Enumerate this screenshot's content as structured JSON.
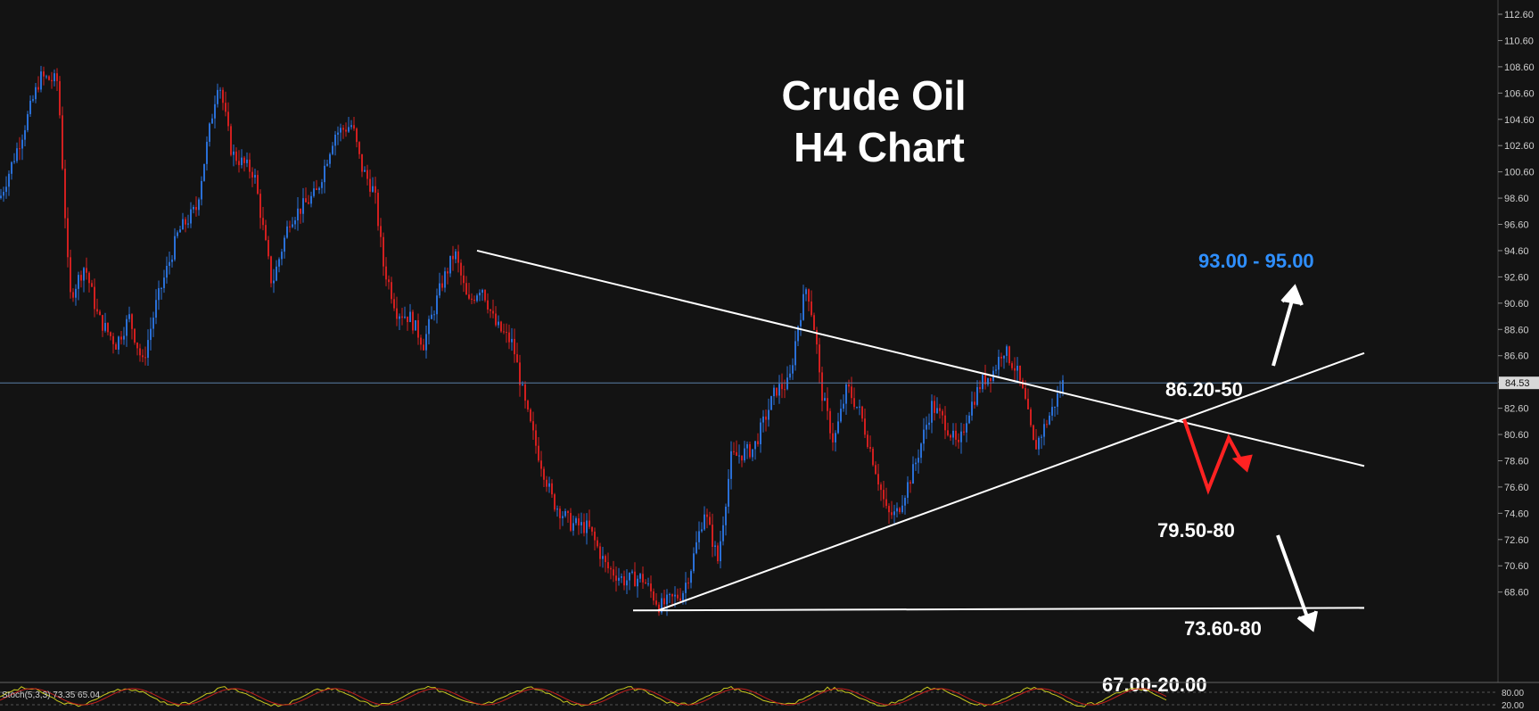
{
  "chart_data": {
    "type": "candlestick",
    "title": [
      "Crude Oil",
      "H4 Chart"
    ],
    "ylim": [
      66.6,
      113.0
    ],
    "y_ticks": [
      "112.60",
      "110.60",
      "108.60",
      "106.60",
      "104.60",
      "102.60",
      "100.60",
      "98.60",
      "96.60",
      "94.60",
      "92.60",
      "90.60",
      "88.60",
      "86.60",
      "84.60",
      "82.60",
      "80.60",
      "78.60",
      "76.60",
      "74.60",
      "72.60",
      "70.60",
      "68.60"
    ],
    "current_price": {
      "value": 84.53,
      "label": "84.53"
    },
    "price_path": [
      [
        0,
        98.6
      ],
      [
        25,
        103.5
      ],
      [
        45,
        107.8
      ],
      [
        65,
        107.5
      ],
      [
        78,
        91.0
      ],
      [
        95,
        93.5
      ],
      [
        110,
        89.5
      ],
      [
        130,
        87.5
      ],
      [
        145,
        89.5
      ],
      [
        160,
        86.0
      ],
      [
        175,
        90.5
      ],
      [
        200,
        96.0
      ],
      [
        220,
        97.8
      ],
      [
        245,
        107.8
      ],
      [
        260,
        102.0
      ],
      [
        285,
        100.5
      ],
      [
        305,
        92.0
      ],
      [
        325,
        97.0
      ],
      [
        355,
        99.0
      ],
      [
        375,
        103.5
      ],
      [
        395,
        104.2
      ],
      [
        405,
        101.0
      ],
      [
        420,
        99.0
      ],
      [
        430,
        93.5
      ],
      [
        445,
        90.0
      ],
      [
        460,
        89.5
      ],
      [
        475,
        87.5
      ],
      [
        495,
        92.0
      ],
      [
        510,
        94.5
      ],
      [
        525,
        90.5
      ],
      [
        540,
        92.0
      ],
      [
        555,
        89.0
      ],
      [
        575,
        87.5
      ],
      [
        590,
        82.5
      ],
      [
        600,
        80.0
      ],
      [
        620,
        75.5
      ],
      [
        640,
        73.8
      ],
      [
        660,
        73.5
      ],
      [
        680,
        70.5
      ],
      [
        700,
        69.5
      ],
      [
        720,
        69.7
      ],
      [
        740,
        67.5
      ],
      [
        765,
        68.5
      ],
      [
        775,
        70.5
      ],
      [
        790,
        74.8
      ],
      [
        805,
        71.0
      ],
      [
        820,
        78.8
      ],
      [
        845,
        79.5
      ],
      [
        870,
        84.0
      ],
      [
        885,
        84.5
      ],
      [
        895,
        89.0
      ],
      [
        905,
        92.0
      ],
      [
        915,
        88.0
      ],
      [
        920,
        84.2
      ],
      [
        935,
        80.0
      ],
      [
        950,
        84.2
      ],
      [
        965,
        82.2
      ],
      [
        980,
        78.5
      ],
      [
        995,
        74.5
      ],
      [
        1005,
        74.5
      ],
      [
        1025,
        78.0
      ],
      [
        1045,
        82.8
      ],
      [
        1060,
        81.5
      ],
      [
        1075,
        79.5
      ],
      [
        1085,
        82.2
      ],
      [
        1100,
        84.5
      ],
      [
        1115,
        85.5
      ],
      [
        1125,
        87.2
      ],
      [
        1140,
        85.5
      ],
      [
        1150,
        83.0
      ],
      [
        1160,
        79.5
      ],
      [
        1170,
        81.0
      ],
      [
        1180,
        82.5
      ],
      [
        1192,
        84.5
      ]
    ],
    "annotations": [
      {
        "text": "93.00 - 95.00",
        "color": "#2f8fff"
      },
      {
        "text": "86.20-50",
        "color": "#ffffff"
      },
      {
        "text": "79.50-80",
        "color": "#ffffff"
      },
      {
        "text": "73.60-80",
        "color": "#ffffff"
      },
      {
        "text": "67.00-20.00",
        "color": "#ffffff"
      }
    ],
    "trendlines": [
      {
        "name": "descending-resistance",
        "from": [
          535,
          94.6
        ],
        "to": [
          1530,
          78.2
        ]
      },
      {
        "name": "ascending-support",
        "from": [
          738,
          67.2
        ],
        "to": [
          1530,
          86.8
        ]
      },
      {
        "name": "horizontal-support",
        "from": [
          710,
          67.2
        ],
        "to": [
          1530,
          67.4
        ]
      }
    ],
    "oscillator": {
      "label": "Stoch(5,3,3) 73.35 65.04",
      "ticks": [
        "80.00",
        "20.00"
      ]
    },
    "colors": {
      "background": "#131313",
      "up_candle": "#2a6fd6",
      "down_candle": "#d11f1f",
      "trendline": "#ffffff",
      "price_line": "#5b7fa8",
      "projection": "#ff2222",
      "osc_k": "#c8c81e",
      "osc_d": "#c01e1e"
    }
  }
}
